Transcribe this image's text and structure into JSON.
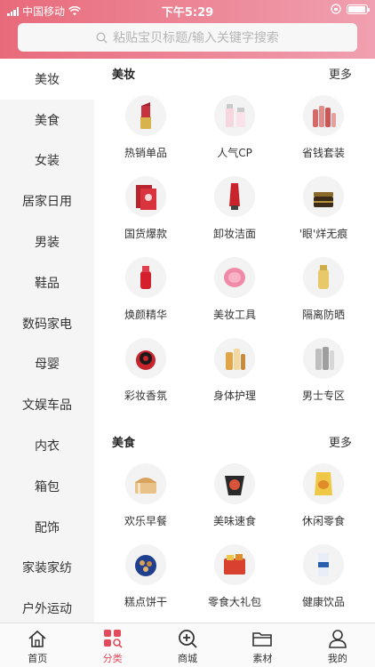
{
  "status_bar": {
    "carrier": "中国移动",
    "time": "下午5:29",
    "battery_level": 0.95
  },
  "search": {
    "placeholder": "粘贴宝贝标题/输入关键字搜索",
    "icon": "search-icon"
  },
  "sidebar": {
    "items": [
      {
        "label": "美妆",
        "active": true
      },
      {
        "label": "美食"
      },
      {
        "label": "女装"
      },
      {
        "label": "居家日用"
      },
      {
        "label": "男装"
      },
      {
        "label": "鞋品"
      },
      {
        "label": "数码家电"
      },
      {
        "label": "母婴"
      },
      {
        "label": "文娱车品"
      },
      {
        "label": "内衣"
      },
      {
        "label": "箱包"
      },
      {
        "label": "配饰"
      },
      {
        "label": "家装家纺"
      },
      {
        "label": "户外运动"
      }
    ]
  },
  "sections": [
    {
      "title": "美妆",
      "more": "更多",
      "items": [
        {
          "label": "热销单品",
          "icon": "lipstick-icon"
        },
        {
          "label": "人气CP",
          "icon": "skincare-bottles-icon"
        },
        {
          "label": "省钱套装",
          "icon": "skincare-set-icon"
        },
        {
          "label": "国货爆款",
          "icon": "face-mask-icon"
        },
        {
          "label": "卸妆洁面",
          "icon": "cleanser-tube-icon"
        },
        {
          "label": "'眼'烊无痕",
          "icon": "eye-cream-jar-icon"
        },
        {
          "label": "焕颜精华",
          "icon": "serum-bottle-icon"
        },
        {
          "label": "美妆工具",
          "icon": "cleansing-brush-icon"
        },
        {
          "label": "隔离防晒",
          "icon": "sunscreen-icon"
        },
        {
          "label": "彩妆香氛",
          "icon": "cushion-compact-icon"
        },
        {
          "label": "身体护理",
          "icon": "body-care-bottles-icon"
        },
        {
          "label": "男士专区",
          "icon": "mens-skincare-icon"
        }
      ]
    },
    {
      "title": "美食",
      "more": "更多",
      "items": [
        {
          "label": "欢乐早餐",
          "icon": "bread-icon"
        },
        {
          "label": "美味速食",
          "icon": "instant-noodles-icon"
        },
        {
          "label": "休闲零食",
          "icon": "chips-bag-icon"
        },
        {
          "label": "糕点饼干",
          "icon": "cookie-tin-icon"
        },
        {
          "label": "零食大礼包",
          "icon": "snack-gift-box-icon"
        },
        {
          "label": "健康饮品",
          "icon": "drink-box-icon"
        }
      ]
    }
  ],
  "tabbar": {
    "items": [
      {
        "label": "首页",
        "icon": "home-icon"
      },
      {
        "label": "分类",
        "icon": "category-icon",
        "active": true
      },
      {
        "label": "商城",
        "icon": "zoom-plus-icon"
      },
      {
        "label": "素材",
        "icon": "folder-icon"
      },
      {
        "label": "我的",
        "icon": "user-icon"
      }
    ]
  },
  "colors": {
    "accent": "#e34b5c",
    "header_start": "#e86a7a",
    "header_end": "#f0a0b0",
    "sidebar_bg": "#f5f5f5"
  }
}
